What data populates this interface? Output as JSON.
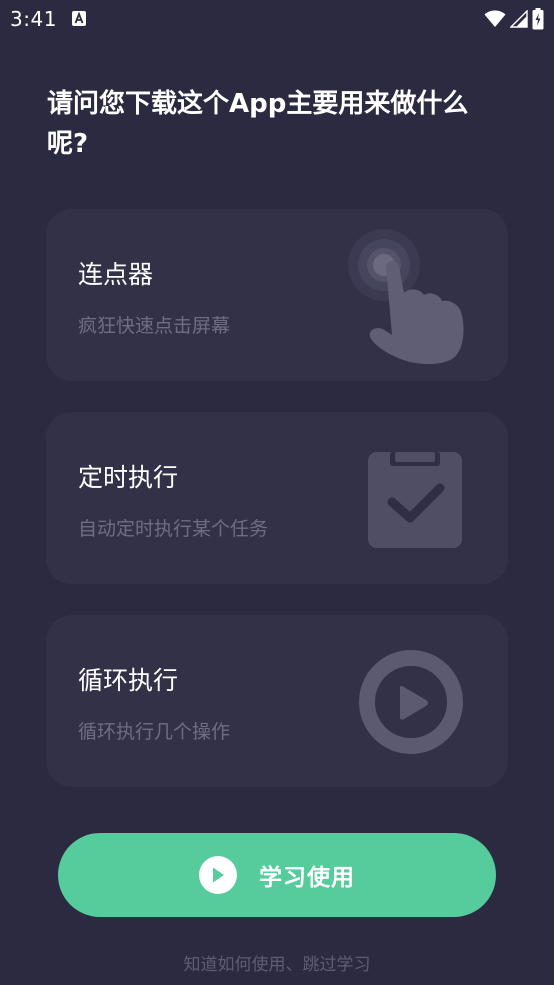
{
  "status_bar": {
    "time": "3:41"
  },
  "question": "请问您下载这个App主要用来做什么呢?",
  "cards": [
    {
      "title": "连点器",
      "subtitle": "疯狂快速点击屏幕",
      "icon": "tap-hand-icon"
    },
    {
      "title": "定时执行",
      "subtitle": "自动定时执行某个任务",
      "icon": "clipboard-check-icon"
    },
    {
      "title": "循环执行",
      "subtitle": "循环执行几个操作",
      "icon": "play-circle-icon"
    }
  ],
  "cta": {
    "label": "学习使用",
    "color": "#56cb9c"
  },
  "skip_link": "知道如何使用、跳过学习",
  "colors": {
    "background": "#2b2a40",
    "card": "#323148",
    "subtitle": "#6e6d85"
  }
}
